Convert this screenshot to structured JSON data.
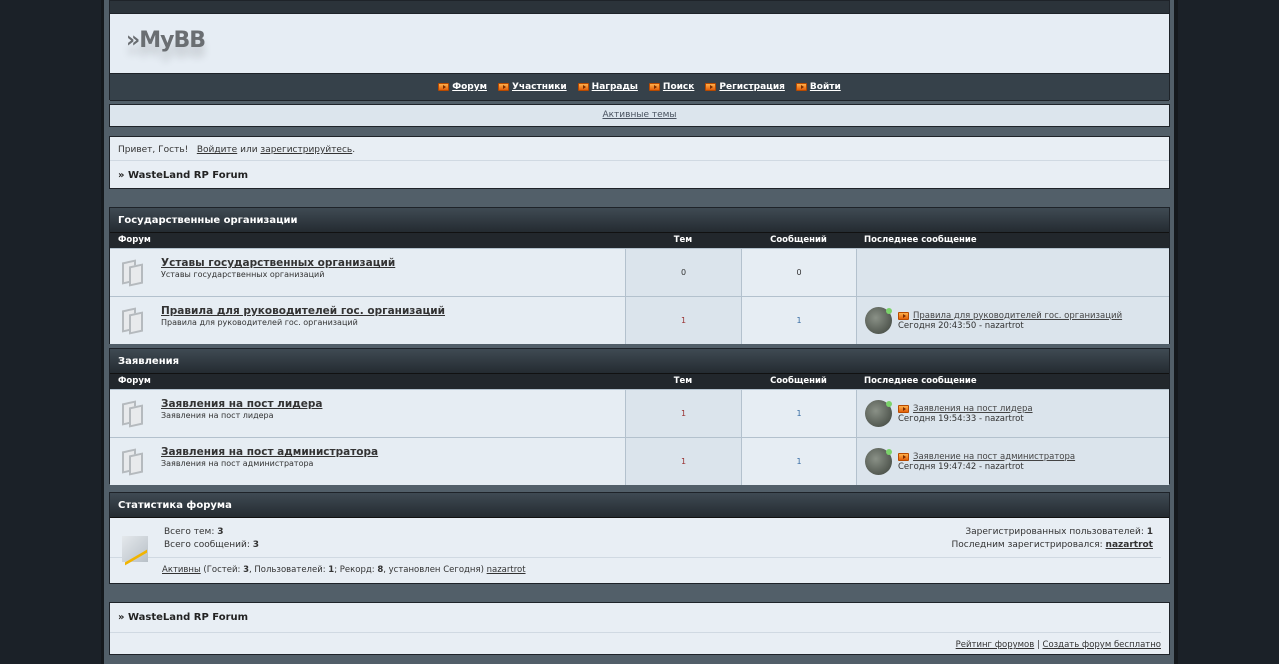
{
  "header": {
    "logo": "MyBB",
    "nav": [
      "Форум",
      "Участники",
      "Награды",
      "Поиск",
      "Регистрация",
      "Войти"
    ]
  },
  "active_topics": "Активные темы",
  "welcome": {
    "greeting": "Привет, Гость!",
    "login": "Войдите",
    "or": "или",
    "register": "зарегистрируйтесь",
    "dot": "."
  },
  "breadcrumb": "WasteLand RP Forum",
  "columns": {
    "forum": "Форум",
    "topics": "Тем",
    "posts": "Сообщений",
    "last": "Последнее сообщение"
  },
  "categories": [
    {
      "title": "Государственные организации",
      "forums": [
        {
          "name": "Уставы государственных организаций",
          "desc": "Уставы государственных организаций",
          "topics": "0",
          "posts": "0"
        },
        {
          "name": "Правила для руководителей гос. организаций",
          "desc": "Правила для руководителей гос. организаций",
          "topics": "1",
          "posts": "1",
          "last_title": "Правила для руководителей гос. организаций",
          "last_date": "Сегодня 20:43:50 - nazartrot"
        }
      ]
    },
    {
      "title": "Заявления",
      "forums": [
        {
          "name": "Заявления на пост лидера",
          "desc": "Заявления на пост лидера",
          "topics": "1",
          "posts": "1",
          "last_title": "Заявления на пост лидера",
          "last_date": "Сегодня 19:54:33 - nazartrot"
        },
        {
          "name": "Заявления на пост администратора",
          "desc": "Заявления на пост администратора",
          "topics": "1",
          "posts": "1",
          "last_title": "Заявление на пост администратора",
          "last_date": "Сегодня 19:47:42 - nazartrot"
        }
      ]
    }
  ],
  "stats": {
    "title": "Статистика форума",
    "topics_label": "Всего тем:",
    "topics": "3",
    "posts_label": "Всего сообщений:",
    "posts": "3",
    "reg_label": "Зарегистрированных пользователей:",
    "reg": "1",
    "last_reg_label": "Последним зарегистрировался:",
    "last_reg": "nazartrot",
    "online_link": "Активны",
    "online_a": " (Гостей: ",
    "guests": "3",
    "online_b": ", Пользователей: ",
    "users": "1",
    "online_c": "; Рекорд: ",
    "record": "8",
    "online_d": ", установлен Сегодня) ",
    "online_user": "nazartrot"
  },
  "footer": {
    "breadcrumb": "WasteLand RP Forum",
    "rating": "Рейтинг форумов",
    "sep": "|",
    "create": "Создать форум бесплатно"
  }
}
